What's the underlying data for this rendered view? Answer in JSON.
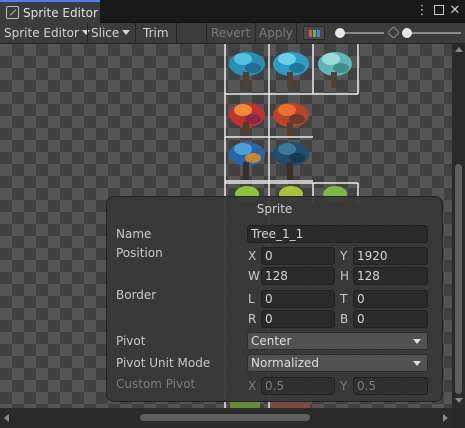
{
  "window": {
    "title": "Sprite Editor",
    "accent": "#4c7eff"
  },
  "toolbar": {
    "sprite_editor_menu": "Sprite Editor",
    "slice_menu": "Slice",
    "trim_label": "Trim",
    "revert_label": "Revert",
    "apply_label": "Apply"
  },
  "sprite_panel": {
    "title": "Sprite",
    "name_label": "Name",
    "name_value": "Tree_1_1",
    "position_label": "Position",
    "x_label": "X",
    "x_value": "0",
    "y_label": "Y",
    "y_value": "1920",
    "w_label": "W",
    "w_value": "128",
    "h_label": "H",
    "h_value": "128",
    "border_label": "Border",
    "border_l_label": "L",
    "border_l_value": "0",
    "border_t_label": "T",
    "border_t_value": "0",
    "border_r_label": "R",
    "border_r_value": "0",
    "border_b_label": "B",
    "border_b_value": "0",
    "pivot_label": "Pivot",
    "pivot_value": "Center",
    "pivot_unit_mode_label": "Pivot Unit Mode",
    "pivot_unit_mode_value": "Normalized",
    "custom_pivot_label": "Custom Pivot",
    "custom_x_label": "X",
    "custom_x_value": "0.5",
    "custom_y_label": "Y",
    "custom_y_value": "0.5"
  },
  "icons": [
    "sprite-editor-icon",
    "more-options-icon",
    "maximize-icon",
    "close-icon",
    "dropdown-caret-icon",
    "color-channel-icon",
    "zoom-slider",
    "mip-slider"
  ]
}
